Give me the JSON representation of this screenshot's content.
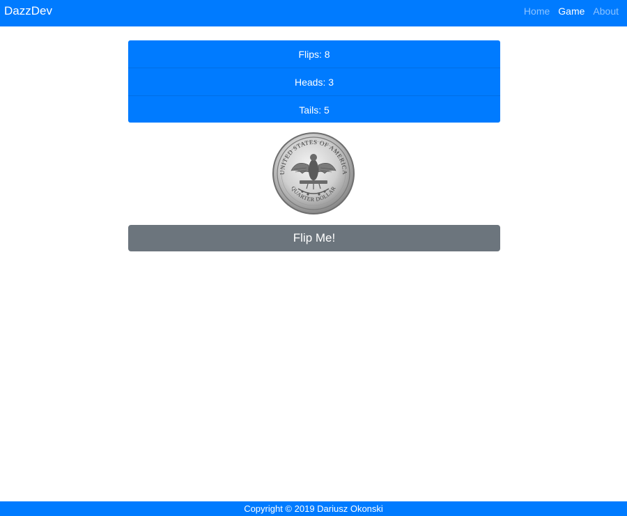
{
  "navbar": {
    "brand": "DazzDev",
    "links": [
      {
        "label": "Home",
        "active": false
      },
      {
        "label": "Game",
        "active": true
      },
      {
        "label": "About",
        "active": false
      }
    ]
  },
  "stats": {
    "flips": "Flips: 8",
    "heads": "Heads: 3",
    "tails": "Tails: 5"
  },
  "coin": {
    "icon": "quarter-dollar-tails-icon",
    "rim_text_top": "UNITED STATES OF AMERICA",
    "rim_text_bottom": "QUARTER DOLLAR"
  },
  "flip_button": {
    "label": "Flip Me!"
  },
  "footer": {
    "text": "Copyright © 2019 Dariusz Okonski"
  },
  "colors": {
    "primary": "#007bff",
    "secondary": "#6c757d"
  }
}
